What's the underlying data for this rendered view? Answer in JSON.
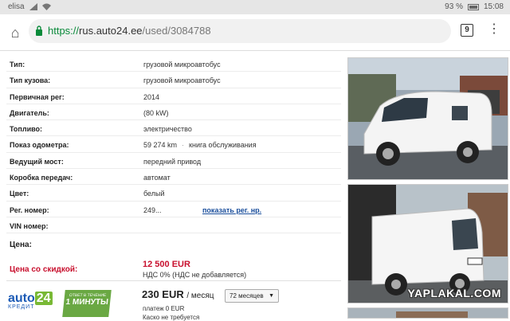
{
  "status": {
    "carrier": "elisa",
    "battery": "93 %",
    "time": "15:08"
  },
  "browser": {
    "url_scheme": "https://",
    "url_host": "rus.auto24.ee",
    "url_path": "/used/3084788",
    "tab_count": "9"
  },
  "specs": [
    {
      "label": "Тип:",
      "value": "грузовой микроавтобус"
    },
    {
      "label": "Тип кузова:",
      "value": "грузовой микроавтобус"
    },
    {
      "label": "Первичная рег:",
      "value": "2014"
    },
    {
      "label": "Двигатель:",
      "value": "(80 kW)"
    },
    {
      "label": "Топливо:",
      "value": "электричество"
    },
    {
      "label": "Показ одометра:",
      "value": "59 274 km",
      "extra": "книга обслуживания"
    },
    {
      "label": "Ведущий мост:",
      "value": "передний привод"
    },
    {
      "label": "Коробка передач:",
      "value": "автомат"
    },
    {
      "label": "Цвет:",
      "value": "белый"
    },
    {
      "label": "Рег. номер:",
      "value": "249...",
      "link": "показать рег. нр."
    },
    {
      "label": "VIN номер:",
      "value": ""
    }
  ],
  "price": {
    "title": "Цена:",
    "discount_label": "Цена со скидкой:",
    "discount_value": "12 500 EUR",
    "vat": "НДС 0% (НДС не добавляется)"
  },
  "credit": {
    "logo_text": "auto",
    "logo_num": "24",
    "logo_sub": "КРЕДИТ",
    "badge_small": "ОТВЕТ В ТЕЧЕНИЕ",
    "badge_big": "1 МИНУТЫ",
    "monthly": "230 EUR",
    "per": "/ месяц",
    "months_select": "72 месяцев",
    "down_payment": "платеж 0 EUR",
    "casco": "Каско не требуется"
  },
  "watermark": "YAPLAKAL.COM",
  "colors": {
    "price_red": "#c8102e",
    "link_blue": "#1b4f9c",
    "url_green": "#0a8a3a",
    "badge_green": "#6aa843"
  }
}
